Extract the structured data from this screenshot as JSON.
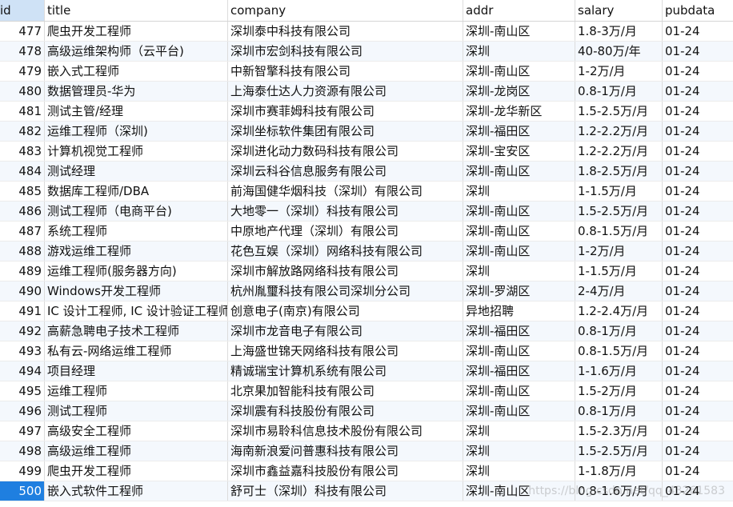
{
  "table": {
    "columns": [
      "id",
      "title",
      "company",
      "addr",
      "salary",
      "pubdata"
    ],
    "rows": [
      {
        "id": "477",
        "title": "爬虫开发工程师",
        "company": "深圳泰中科技有限公司",
        "addr": "深圳-南山区",
        "salary": "1.8-3万/月",
        "pubdata": "01-24"
      },
      {
        "id": "478",
        "title": "高级运维架构师（云平台)",
        "company": "深圳市宏剑科技有限公司",
        "addr": "深圳",
        "salary": "40-80万/年",
        "pubdata": "01-24"
      },
      {
        "id": "479",
        "title": "嵌入式工程师",
        "company": "中新智擎科技有限公司",
        "addr": "深圳-南山区",
        "salary": "1-2万/月",
        "pubdata": "01-24"
      },
      {
        "id": "480",
        "title": "数据管理员-华为",
        "company": "上海泰仕达人力资源有限公司",
        "addr": "深圳-龙岗区",
        "salary": "0.8-1万/月",
        "pubdata": "01-24"
      },
      {
        "id": "481",
        "title": "测试主管/经理",
        "company": "深圳市赛菲姆科技有限公司",
        "addr": "深圳-龙华新区",
        "salary": "1.5-2.5万/月",
        "pubdata": "01-24"
      },
      {
        "id": "482",
        "title": "运维工程师（深圳)",
        "company": "深圳坐标软件集团有限公司",
        "addr": "深圳-福田区",
        "salary": "1.2-2.2万/月",
        "pubdata": "01-24"
      },
      {
        "id": "483",
        "title": "计算机视觉工程师",
        "company": "深圳进化动力数码科技有限公司",
        "addr": "深圳-宝安区",
        "salary": "1.2-2.2万/月",
        "pubdata": "01-24"
      },
      {
        "id": "484",
        "title": "测试经理",
        "company": "深圳云科谷信息服务有限公司",
        "addr": "深圳-南山区",
        "salary": "1.8-2.5万/月",
        "pubdata": "01-24"
      },
      {
        "id": "485",
        "title": "数据库工程师/DBA",
        "company": "前海国健华烟科技（深圳）有限公司",
        "addr": "深圳",
        "salary": "1-1.5万/月",
        "pubdata": "01-24"
      },
      {
        "id": "486",
        "title": "测试工程师（电商平台)",
        "company": "大地零一（深圳）科技有限公司",
        "addr": "深圳-南山区",
        "salary": "1.5-2.5万/月",
        "pubdata": "01-24"
      },
      {
        "id": "487",
        "title": "系统工程师",
        "company": "中原地产代理（深圳）有限公司",
        "addr": "深圳-南山区",
        "salary": "0.8-1.5万/月",
        "pubdata": "01-24"
      },
      {
        "id": "488",
        "title": "游戏运维工程师",
        "company": "花色互娱（深圳）网络科技有限公司",
        "addr": "深圳-南山区",
        "salary": "1-2万/月",
        "pubdata": "01-24"
      },
      {
        "id": "489",
        "title": "运维工程师(服务器方向)",
        "company": "深圳市解放路网络科技有限公司",
        "addr": "深圳",
        "salary": "1-1.5万/月",
        "pubdata": "01-24"
      },
      {
        "id": "490",
        "title": "Windows开发工程师",
        "company": "杭州胤璽科技有限公司深圳分公司",
        "addr": "深圳-罗湖区",
        "salary": "2-4万/月",
        "pubdata": "01-24"
      },
      {
        "id": "491",
        "title": "IC 设计工程师, IC 设计验证工程师",
        "company": "创意电子(南京)有限公司",
        "addr": "异地招聘",
        "salary": "1.2-2.4万/月",
        "pubdata": "01-24"
      },
      {
        "id": "492",
        "title": "高薪急聘电子技术工程师",
        "company": "深圳市龙音电子有限公司",
        "addr": "深圳-福田区",
        "salary": "0.8-1万/月",
        "pubdata": "01-24"
      },
      {
        "id": "493",
        "title": "私有云-网络运维工程师",
        "company": "上海盛世锦天网络科技有限公司",
        "addr": "深圳-南山区",
        "salary": "0.8-1.5万/月",
        "pubdata": "01-24"
      },
      {
        "id": "494",
        "title": "项目经理",
        "company": "精诚瑞宝计算机系统有限公司",
        "addr": "深圳-福田区",
        "salary": "1-1.6万/月",
        "pubdata": "01-24"
      },
      {
        "id": "495",
        "title": "运维工程师",
        "company": "北京果加智能科技有限公司",
        "addr": "深圳-南山区",
        "salary": "1.5-2万/月",
        "pubdata": "01-24"
      },
      {
        "id": "496",
        "title": "测试工程师",
        "company": "深圳震有科技股份有限公司",
        "addr": "深圳-南山区",
        "salary": "0.8-1万/月",
        "pubdata": "01-24"
      },
      {
        "id": "497",
        "title": "高级安全工程师",
        "company": "深圳市易聆科信息技术股份有限公司",
        "addr": "深圳",
        "salary": "1.5-2.3万/月",
        "pubdata": "01-24"
      },
      {
        "id": "498",
        "title": "高级运维工程师",
        "company": "海南新浪爱问普惠科技有限公司",
        "addr": "深圳",
        "salary": "1.5-2.5万/月",
        "pubdata": "01-24"
      },
      {
        "id": "499",
        "title": "爬虫开发工程师",
        "company": "深圳市鑫益嘉科技股份有限公司",
        "addr": "深圳",
        "salary": "1-1.8万/月",
        "pubdata": "01-24"
      },
      {
        "id": "500",
        "title": "嵌入式软件工程师",
        "company": "舒可士（深圳）科技有限公司",
        "addr": "深圳-南山区",
        "salary": "0.8-1.6万/月",
        "pubdata": "01-24"
      }
    ],
    "selected_row_id": "500"
  },
  "watermark": "https://blog.csdn.net/qq_43261583",
  "colors": {
    "header_id_bg": "#cfe2f6",
    "selected_bg": "#1f7fe0",
    "alt_row_bg": "#f4f8fd"
  }
}
